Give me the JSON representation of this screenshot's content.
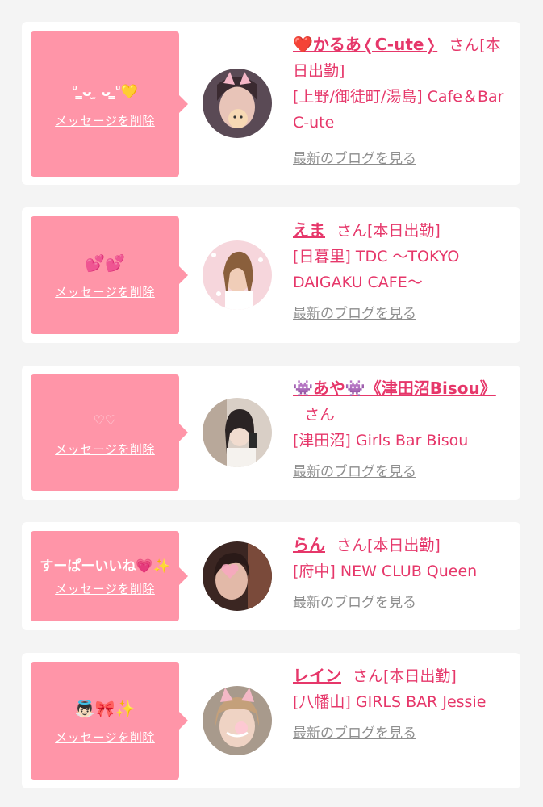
{
  "cards": [
    {
      "message": "ᐡ ̳ᴗ ̫ ᴗ ̳ᐡ💛",
      "delete_label": "メッセージを削除",
      "name": "❤️かるあ❬C-ute❭",
      "san": "さん",
      "status": "[本日出勤]",
      "shop": "[上野/御徒町/湯島] Cafe＆Bar C-ute",
      "blog_label": "最新のブログを見る"
    },
    {
      "message": "💕💕",
      "delete_label": "メッセージを削除",
      "name": "えま",
      "san": "さん",
      "status": "[本日出勤]",
      "shop": "[日暮里] TDC 〜TOKYO DAIGAKU CAFE〜",
      "blog_label": "最新のブログを見る"
    },
    {
      "message": "♡♡",
      "delete_label": "メッセージを削除",
      "name": "👾あや👾《津田沼Bisou》",
      "san": "さん",
      "status": "",
      "shop": "[津田沼] Girls Bar Bisou",
      "blog_label": "最新のブログを見る"
    },
    {
      "message": "すーぱーいいね💗✨",
      "delete_label": "メッセージを削除",
      "name": "らん",
      "san": "さん",
      "status": "[本日出勤]",
      "shop": "[府中] NEW CLUB Queen",
      "blog_label": "最新のブログを見る"
    },
    {
      "message": "👼🏻🎀✨",
      "delete_label": "メッセージを削除",
      "name": "レイン",
      "san": "さん",
      "status": "[本日出勤]",
      "shop": "[八幡山] GIRLS BAR Jessie",
      "blog_label": "最新のブログを見る"
    }
  ],
  "colors": {
    "accent": "#e6376a",
    "bubble": "#ff95a8",
    "background": "#f4f4f4",
    "blog_link": "#8e8e8e"
  }
}
